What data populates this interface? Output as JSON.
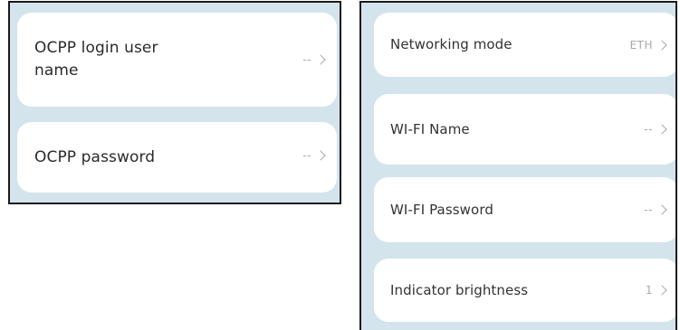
{
  "left_panel": {
    "items": [
      {
        "label": "OCPP login user name",
        "value": "--"
      },
      {
        "label": "OCPP password",
        "value": "--"
      }
    ]
  },
  "right_panel": {
    "items": [
      {
        "label": "Networking mode",
        "value": "ETH"
      },
      {
        "label": "WI-FI Name",
        "value": "--"
      },
      {
        "label": "WI-FI Password",
        "value": "--"
      },
      {
        "label": "Indicator brightness",
        "value": "1"
      }
    ]
  },
  "icons": {
    "chevron": "chevron-right-icon"
  },
  "colors": {
    "panel_background": "#d4e4ec",
    "card_background": "#ffffff",
    "label_text": "#2b2b2b",
    "value_text": "#a8a8a8",
    "panel_border": "#1a1a1a"
  }
}
